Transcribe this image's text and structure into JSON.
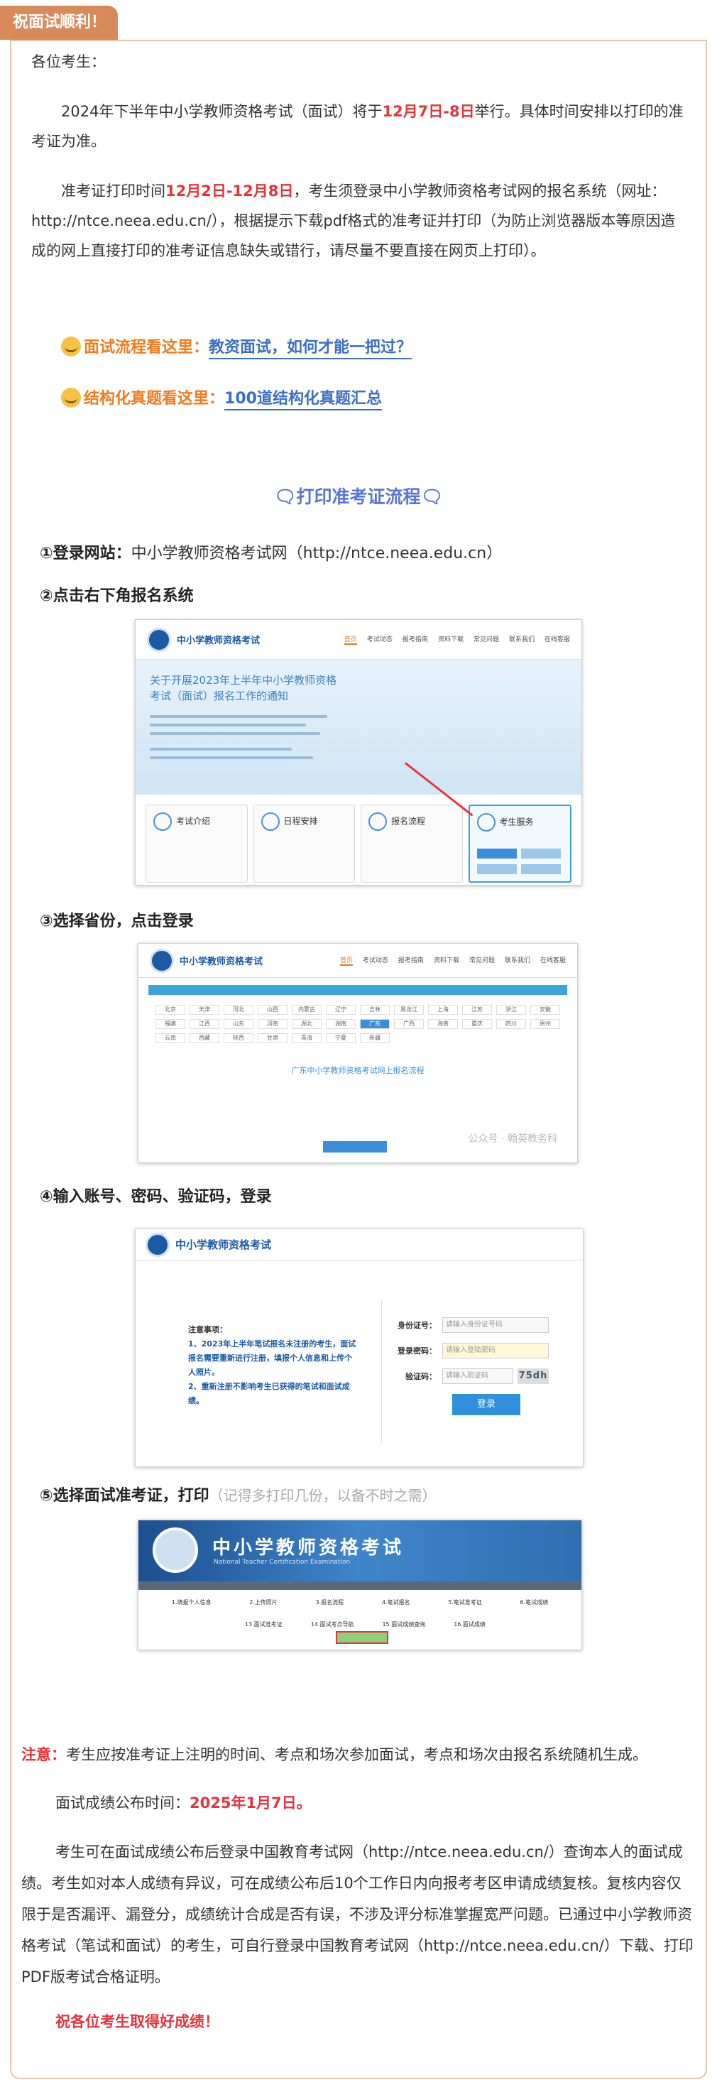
{
  "header": {
    "tag": "祝面试顺利！"
  },
  "intro": {
    "greeting": "各位考生：",
    "p1_a": "2024年下半年中小学教师资格考试（面试）将于",
    "p1_date": "12月7日-8日",
    "p1_b": "举行。具体时间安排以打印的准考证为准。",
    "p2_a": "准考证打印时间",
    "p2_date": "12月2日-12月8日",
    "p2_b": "，考生须登录中小学教师资格考试网的报名系统（网址：http://ntce.neea.edu.cn/），根据提示下载pdf格式的准考证并打印（为防止浏览器版本等原因造成的网上直接打印的准考证信息缺失或错行，请尽量不要直接在网页上打印）。"
  },
  "guides": [
    {
      "label": "面试流程看这里：",
      "link": "教资面试，如何才能一把过？"
    },
    {
      "label": "结构化真题看这里：",
      "link": "100道结构化真题汇总"
    }
  ],
  "flow": {
    "title": "🗨打印准考证流程🗨",
    "step1": "①登录网站：",
    "step1_site": "中小学教师资格考试网（http://ntce.neea.edu.cn）",
    "step2": "②点击右下角报名系统",
    "step3": "③选择省份，点击登录",
    "step4": "④输入账号、密码、验证码，登录",
    "step5": "⑤选择面试准考证，打印",
    "step5_note": "（记得多打印几份，以备不时之需）"
  },
  "shot1": {
    "title": "中小学教师资格考试",
    "nav": [
      "首页",
      "考试动态",
      "报考指南",
      "资料下载",
      "常见问题",
      "联系我们",
      "在线客服"
    ],
    "banner": "关于开展2023年上半年中小学教师资格考试（面试）报名工作的通知",
    "cards": [
      "考试介绍",
      "日程安排",
      "报名流程",
      "考生服务"
    ]
  },
  "shot2": {
    "title": "中小学教师资格考试",
    "nav": [
      "首页",
      "考试动态",
      "报考指南",
      "资料下载",
      "常见问题",
      "联系我们",
      "在线客服"
    ],
    "provinces": [
      "北京",
      "天津",
      "河北",
      "山西",
      "内蒙古",
      "辽宁",
      "吉林",
      "黑龙江",
      "上海",
      "江苏",
      "浙江",
      "安徽",
      "福建",
      "江西",
      "山东",
      "河南",
      "湖北",
      "湖南",
      "广东",
      "广西",
      "海南",
      "重庆",
      "四川",
      "贵州",
      "云南",
      "西藏",
      "陕西",
      "甘肃",
      "青海",
      "宁夏",
      "新疆"
    ],
    "selected": "广东",
    "link": "广东中小学教师资格考试网上报名流程",
    "watermark": "公众号 · 翰英教务科"
  },
  "shot3": {
    "title": "中小学教师资格考试",
    "notice_title": "注意事项：",
    "notice1": "1、2023年上半年笔试报名未注册的考生，面试报名需要重新进行注册，填报个人信息和上传个人照片。",
    "notice2": "2、重新注册不影响考生已获得的笔试和面试成绩。",
    "fields": [
      {
        "label": "身份证号：",
        "placeholder": "请输入身份证号码"
      },
      {
        "label": "登录密码：",
        "placeholder": "请输入登陆密码"
      },
      {
        "label": "验证码：",
        "placeholder": "请输入验证码"
      }
    ],
    "captcha": "75dh",
    "login": "登录"
  },
  "shot4": {
    "title": "中小学教师资格考试",
    "subtitle": "National Teacher Certification Examination",
    "steps": [
      "1.填报个人信息",
      "2.上传照片",
      "3.报名流程",
      "4.笔试报名",
      "5.笔试准考证",
      "6.笔试成绩"
    ],
    "steps2": [
      "13.面试准考证",
      "14.面试考点导航",
      "15.面试成绩查询",
      "16.面试成绩"
    ]
  },
  "footer": {
    "note_label": "注意：",
    "note_text": "考生应按准考证上注明的时间、考点和场次参加面试，考点和场次由报名系统随机生成。",
    "result_a": "面试成绩公布时间：",
    "result_date": "2025年1月7日。",
    "p3": "考生可在面试成绩公布后登录中国教育考试网（http://ntce.neea.edu.cn/）查询本人的面试成绩。考生如对本人成绩有异议，可在成绩公布后10个工作日内向报考考区申请成绩复核。复核内容仅限于是否漏评、漏登分，成绩统计合成是否有误，不涉及评分标准掌握宽严问题。已通过中小学教师资格考试（笔试和面试）的考生，可自行登录中国教育考试网（http://ntce.neea.edu.cn/）下载、打印PDF版考试合格证明。",
    "wish": "祝各位考生取得好成绩！"
  }
}
